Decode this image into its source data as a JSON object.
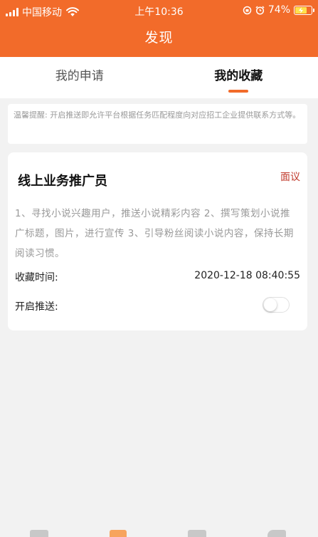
{
  "status_bar": {
    "carrier": "中国移动",
    "time": "上午10:36",
    "battery": "74%"
  },
  "nav": {
    "title": "发现"
  },
  "tabs": [
    {
      "label": "我的申请",
      "active": false
    },
    {
      "label": "我的收藏",
      "active": true
    }
  ],
  "notice": {
    "text": "温馨提醒: 开启推送即允许平台根据任务匹配程度向对应招工企业提供联系方式等。"
  },
  "card": {
    "title": "线上业务推广员",
    "action_label": "面议",
    "description": "1、寻找小说兴趣用户，推送小说精彩内容 2、撰写策划小说推广标题，图片，进行宣传 3、引导粉丝阅读小说内容，保持长期阅读习惯。",
    "favorite_time_label": "收藏时间:",
    "favorite_time_value": "2020-12-18 08:40:55",
    "push_label": "开启推送:",
    "push_enabled": false
  },
  "colors": {
    "brand": "#f26b2a",
    "interview_text": "#c0392b"
  }
}
